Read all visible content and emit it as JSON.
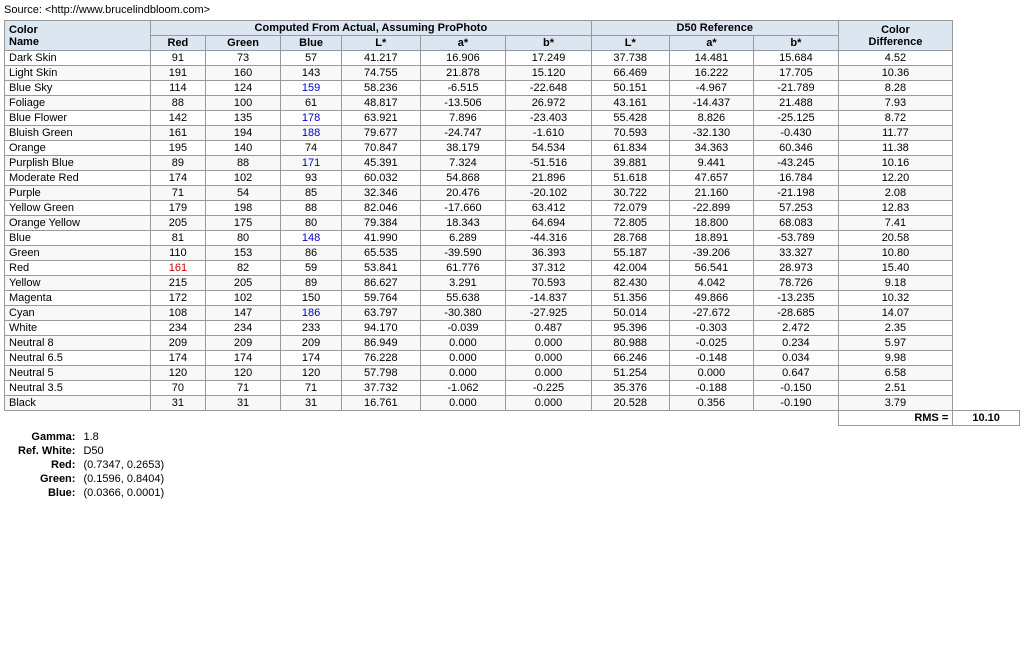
{
  "source": "Source: <http://www.brucelindbloom.com>",
  "header": {
    "col1": "Color\nName",
    "computed_group": "Computed From Actual, Assuming ProPhoto",
    "d50_group": "D50 Reference",
    "col_diff": "Color\nDifference",
    "computed_cols": [
      "Red",
      "Green",
      "Blue",
      "L*",
      "a*",
      "b*"
    ],
    "d50_cols": [
      "L*",
      "a*",
      "b*"
    ]
  },
  "rows": [
    {
      "name": "Dark Skin",
      "red": "91",
      "green": "73",
      "blue": "57",
      "cL": "41.217",
      "ca": "16.906",
      "cb": "17.249",
      "dL": "37.738",
      "da": "14.481",
      "db": "15.684",
      "diff": "4.52",
      "nameColor": null,
      "blueColor": null
    },
    {
      "name": "Light Skin",
      "red": "191",
      "green": "160",
      "blue": "143",
      "cL": "74.755",
      "ca": "21.878",
      "cb": "15.120",
      "dL": "66.469",
      "da": "16.222",
      "db": "17.705",
      "diff": "10.36",
      "nameColor": null,
      "blueColor": null
    },
    {
      "name": "Blue Sky",
      "red": "114",
      "green": "124",
      "blue": "159",
      "cL": "58.236",
      "ca": "-6.515",
      "cb": "-22.648",
      "dL": "50.151",
      "da": "-4.967",
      "db": "-21.789",
      "diff": "8.28",
      "nameColor": null,
      "blueColor": "blue"
    },
    {
      "name": "Foliage",
      "red": "88",
      "green": "100",
      "blue": "61",
      "cL": "48.817",
      "ca": "-13.506",
      "cb": "26.972",
      "dL": "43.161",
      "da": "-14.437",
      "db": "21.488",
      "diff": "7.93",
      "nameColor": null,
      "blueColor": null
    },
    {
      "name": "Blue Flower",
      "red": "142",
      "green": "135",
      "blue": "178",
      "cL": "63.921",
      "ca": "7.896",
      "cb": "-23.403",
      "dL": "55.428",
      "da": "8.826",
      "db": "-25.125",
      "diff": "8.72",
      "nameColor": null,
      "blueColor": "blue"
    },
    {
      "name": "Bluish Green",
      "red": "161",
      "green": "194",
      "blue": "188",
      "cL": "79.677",
      "ca": "-24.747",
      "cb": "-1.610",
      "dL": "70.593",
      "da": "-32.130",
      "db": "-0.430",
      "diff": "11.77",
      "nameColor": null,
      "blueColor": "blue"
    },
    {
      "name": "Orange",
      "red": "195",
      "green": "140",
      "blue": "74",
      "cL": "70.847",
      "ca": "38.179",
      "cb": "54.534",
      "dL": "61.834",
      "da": "34.363",
      "db": "60.346",
      "diff": "11.38",
      "nameColor": null,
      "blueColor": null
    },
    {
      "name": "Purplish Blue",
      "red": "89",
      "green": "88",
      "blue": "171",
      "cL": "45.391",
      "ca": "7.324",
      "cb": "-51.516",
      "dL": "39.881",
      "da": "9.441",
      "db": "-43.245",
      "diff": "10.16",
      "nameColor": null,
      "blueColor": "blue"
    },
    {
      "name": "Moderate Red",
      "red": "174",
      "green": "102",
      "blue": "93",
      "cL": "60.032",
      "ca": "54.868",
      "cb": "21.896",
      "dL": "51.618",
      "da": "47.657",
      "db": "16.784",
      "diff": "12.20",
      "nameColor": null,
      "blueColor": null
    },
    {
      "name": "Purple",
      "red": "71",
      "green": "54",
      "blue": "85",
      "cL": "32.346",
      "ca": "20.476",
      "cb": "-20.102",
      "dL": "30.722",
      "da": "21.160",
      "db": "-21.198",
      "diff": "2.08",
      "nameColor": null,
      "blueColor": null
    },
    {
      "name": "Yellow Green",
      "red": "179",
      "green": "198",
      "blue": "88",
      "cL": "82.046",
      "ca": "-17.660",
      "cb": "63.412",
      "dL": "72.079",
      "da": "-22.899",
      "db": "57.253",
      "diff": "12.83",
      "nameColor": null,
      "blueColor": null
    },
    {
      "name": "Orange Yellow",
      "red": "205",
      "green": "175",
      "blue": "80",
      "cL": "79.384",
      "ca": "18.343",
      "cb": "64.694",
      "dL": "72.805",
      "da": "18.800",
      "db": "68.083",
      "diff": "7.41",
      "nameColor": null,
      "blueColor": null
    },
    {
      "name": "Blue",
      "red": "81",
      "green": "80",
      "blue": "148",
      "cL": "41.990",
      "ca": "6.289",
      "cb": "-44.316",
      "dL": "28.768",
      "da": "18.891",
      "db": "-53.789",
      "diff": "20.58",
      "nameColor": null,
      "blueColor": "blue"
    },
    {
      "name": "Green",
      "red": "110",
      "green": "153",
      "blue": "86",
      "cL": "65.535",
      "ca": "-39.590",
      "cb": "36.393",
      "dL": "55.187",
      "da": "-39.206",
      "db": "33.327",
      "diff": "10.80",
      "nameColor": null,
      "blueColor": null
    },
    {
      "name": "Red",
      "red": "161",
      "green": "82",
      "blue": "59",
      "cL": "53.841",
      "ca": "61.776",
      "cb": "37.312",
      "dL": "42.004",
      "da": "56.541",
      "db": "28.973",
      "diff": "15.40",
      "nameColor": "red",
      "blueColor": null
    },
    {
      "name": "Yellow",
      "red": "215",
      "green": "205",
      "blue": "89",
      "cL": "86.627",
      "ca": "3.291",
      "cb": "70.593",
      "dL": "82.430",
      "da": "4.042",
      "db": "78.726",
      "diff": "9.18",
      "nameColor": null,
      "blueColor": null
    },
    {
      "name": "Magenta",
      "red": "172",
      "green": "102",
      "blue": "150",
      "cL": "59.764",
      "ca": "55.638",
      "cb": "-14.837",
      "dL": "51.356",
      "da": "49.866",
      "db": "-13.235",
      "diff": "10.32",
      "nameColor": null,
      "blueColor": null
    },
    {
      "name": "Cyan",
      "red": "108",
      "green": "147",
      "blue": "186",
      "cL": "63.797",
      "ca": "-30.380",
      "cb": "-27.925",
      "dL": "50.014",
      "da": "-27.672",
      "db": "-28.685",
      "diff": "14.07",
      "nameColor": null,
      "blueColor": "blue"
    },
    {
      "name": "White",
      "red": "234",
      "green": "234",
      "blue": "233",
      "cL": "94.170",
      "ca": "-0.039",
      "cb": "0.487",
      "dL": "95.396",
      "da": "-0.303",
      "db": "2.472",
      "diff": "2.35",
      "nameColor": null,
      "blueColor": null
    },
    {
      "name": "Neutral 8",
      "red": "209",
      "green": "209",
      "blue": "209",
      "cL": "86.949",
      "ca": "0.000",
      "cb": "0.000",
      "dL": "80.988",
      "da": "-0.025",
      "db": "0.234",
      "diff": "5.97",
      "nameColor": null,
      "blueColor": null
    },
    {
      "name": "Neutral 6.5",
      "red": "174",
      "green": "174",
      "blue": "174",
      "cL": "76.228",
      "ca": "0.000",
      "cb": "0.000",
      "dL": "66.246",
      "da": "-0.148",
      "db": "0.034",
      "diff": "9.98",
      "nameColor": null,
      "blueColor": null
    },
    {
      "name": "Neutral 5",
      "red": "120",
      "green": "120",
      "blue": "120",
      "cL": "57.798",
      "ca": "0.000",
      "cb": "0.000",
      "dL": "51.254",
      "da": "0.000",
      "db": "0.647",
      "diff": "6.58",
      "nameColor": null,
      "blueColor": null
    },
    {
      "name": "Neutral 3.5",
      "red": "70",
      "green": "71",
      "blue": "71",
      "cL": "37.732",
      "ca": "-1.062",
      "cb": "-0.225",
      "dL": "35.376",
      "da": "-0.188",
      "db": "-0.150",
      "diff": "2.51",
      "nameColor": null,
      "blueColor": null
    },
    {
      "name": "Black",
      "red": "31",
      "green": "31",
      "blue": "31",
      "cL": "16.761",
      "ca": "0.000",
      "cb": "0.000",
      "dL": "20.528",
      "da": "0.356",
      "db": "-0.190",
      "diff": "3.79",
      "nameColor": null,
      "blueColor": null
    }
  ],
  "rms": "10.10",
  "footer": {
    "gamma_label": "Gamma:",
    "gamma_val": "1.8",
    "refwhite_label": "Ref. White:",
    "refwhite_val": "D50",
    "red_label": "Red:",
    "red_val": "(0.7347, 0.2653)",
    "green_label": "Green:",
    "green_val": "(0.1596, 0.8404)",
    "blue_label": "Blue:",
    "blue_val": "(0.0366, 0.0001)"
  }
}
